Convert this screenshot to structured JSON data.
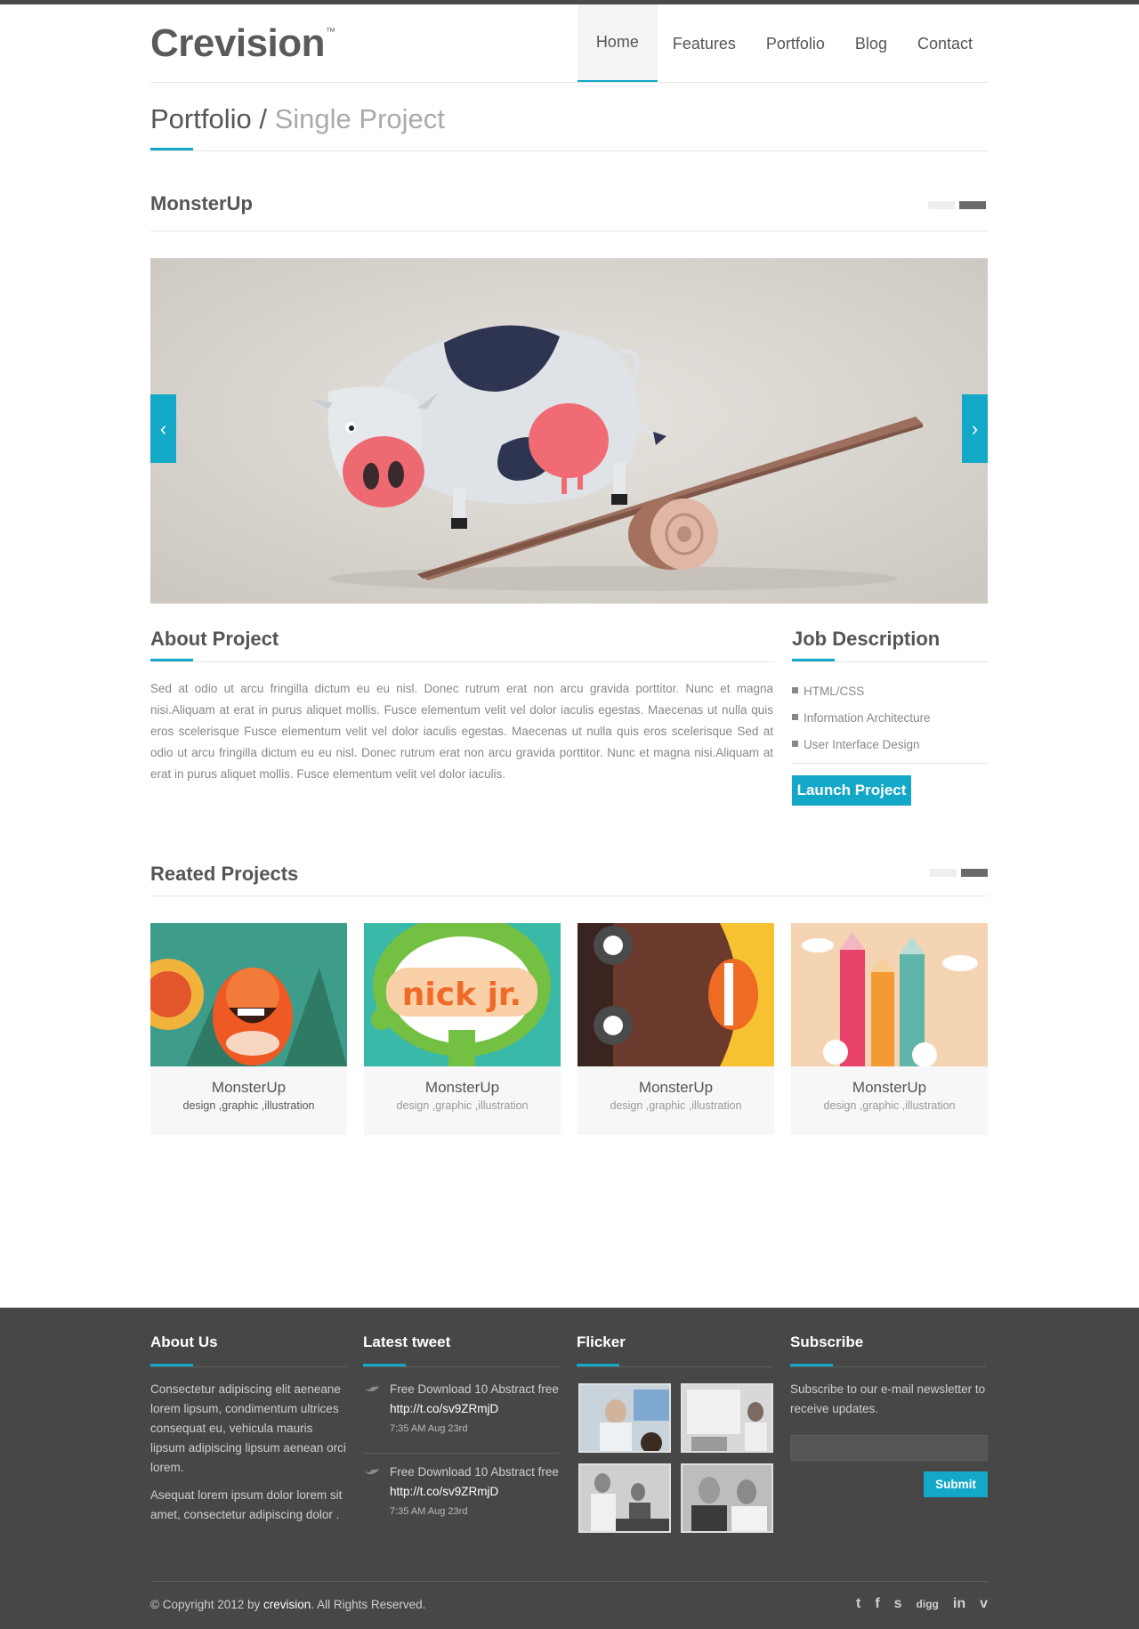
{
  "header": {
    "logo": "Crevision",
    "logo_mark": "™",
    "nav": [
      "Home",
      "Features",
      "Portfolio",
      "Blog",
      "Contact"
    ],
    "active_nav": "Home"
  },
  "breadcrumb": {
    "section": "Portfolio",
    "separator": "/",
    "page": "Single Project"
  },
  "project": {
    "title": "MonsterUp",
    "prev_arrow": "‹",
    "next_arrow": "›"
  },
  "about": {
    "title": "About Project",
    "text": "Sed at odio ut arcu fringilla dictum eu eu nisl. Donec rutrum erat non arcu gravida porttitor. Nunc et magna nisi.Aliquam at erat in purus aliquet mollis. Fusce elementum velit vel dolor iaculis egestas. Maecenas ut nulla quis eros scelerisque Fusce elementum velit vel dolor iaculis egestas. Maecenas ut nulla quis eros scelerisque Sed at odio ut arcu fringilla dictum eu eu nisl. Donec rutrum erat non arcu gravida porttitor. Nunc et magna nisi.Aliquam at erat in purus aliquet mollis. Fusce elementum velit vel dolor iaculis."
  },
  "job": {
    "title": "Job Description",
    "items": [
      "HTML/CSS",
      "Information Architecture",
      "User Interface Design"
    ],
    "button": "Launch Project"
  },
  "related": {
    "title": "Reated Projects",
    "cards": [
      {
        "name": "MonsterUp",
        "tags": "design ,graphic ,illustration"
      },
      {
        "name": "MonsterUp",
        "tags": "design ,graphic ,illustration"
      },
      {
        "name": "MonsterUp",
        "tags": "design ,graphic ,illustration"
      },
      {
        "name": "MonsterUp",
        "tags": "design ,graphic ,illustration"
      }
    ]
  },
  "footer": {
    "about_title": "About Us",
    "about_p1": "Consectetur adipiscing elit aeneane lorem lipsum, condimentum ultrices consequat eu, vehicula mauris lipsum adipiscing lipsum aenean orci lorem.",
    "about_p2": "Asequat lorem ipsum dolor lorem sit amet, consectetur adipiscing dolor .",
    "tweet_title": "Latest tweet",
    "tweets": [
      {
        "text": "Free Download 10 Abstract free",
        "link": "http://t.co/sv9ZRmjD",
        "time": "7:35 AM Aug 23rd"
      },
      {
        "text": "Free Download 10 Abstract free",
        "link": "http://t.co/sv9ZRmjD",
        "time": "7:35 AM Aug 23rd"
      }
    ],
    "flicker_title": "Flicker",
    "subscribe_title": "Subscribe",
    "subscribe_text": "Subscribe to our e-mail newsletter to receive updates.",
    "subscribe_button": "Submit",
    "copyright_pre": "© Copyright 2012 by ",
    "copyright_brand": "crevision",
    "copyright_post": ". All Rights Reserved.",
    "social": [
      "twitter-icon",
      "facebook-icon",
      "skype-icon",
      "digg-icon",
      "linkedin-icon",
      "vimeo-icon"
    ],
    "social_labels": [
      "t",
      "f",
      "s",
      "digg",
      "in",
      "v"
    ]
  },
  "colors": {
    "accent": "#14a8c8",
    "footer_bg": "#474747",
    "text": "#555555"
  }
}
